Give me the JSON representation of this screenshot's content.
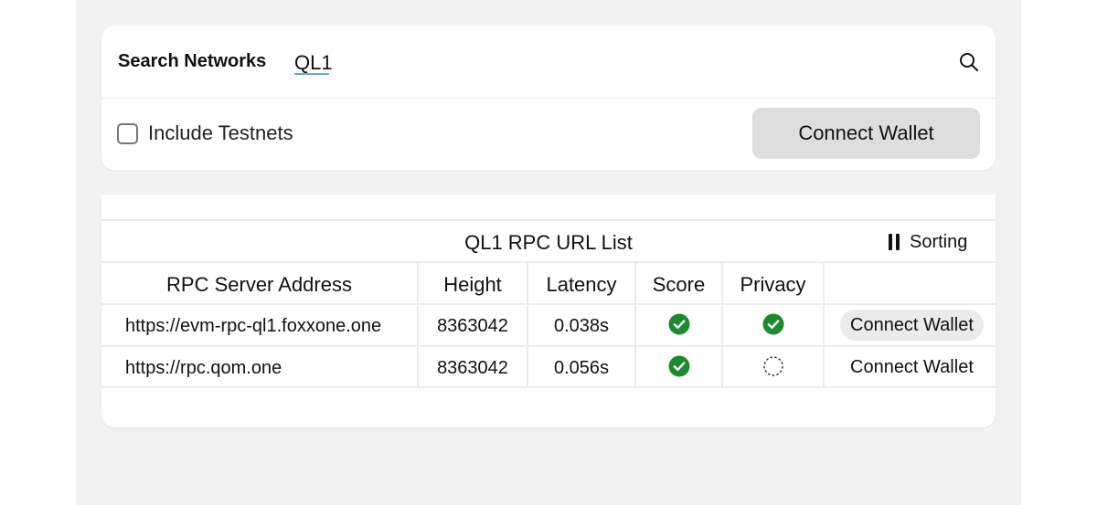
{
  "search": {
    "label": "Search Networks",
    "value": "QL1"
  },
  "options": {
    "include_testnets_label": "Include Testnets",
    "include_testnets_checked": false,
    "connect_wallet_label": "Connect Wallet"
  },
  "table": {
    "title": "QL1 RPC URL List",
    "sorting_label": "Sorting",
    "columns": [
      "RPC Server Address",
      "Height",
      "Latency",
      "Score",
      "Privacy",
      ""
    ],
    "rows": [
      {
        "address": "https://evm-rpc-ql1.foxxone.one",
        "height": "8363042",
        "latency": "0.038s",
        "score": "ok",
        "privacy": "ok",
        "action": "Connect Wallet"
      },
      {
        "address": "https://rpc.qom.one",
        "height": "8363042",
        "latency": "0.056s",
        "score": "ok",
        "privacy": "unknown",
        "action": "Connect Wallet"
      }
    ]
  },
  "colors": {
    "check_green": "#1e8a2f",
    "button_gray": "#dedede",
    "page_gray": "#f2f2f2",
    "underline_blue": "#6aa3e8"
  },
  "icons": {
    "search": "search-icon",
    "sorting": "pause-icon",
    "ok": "check-circle-icon",
    "unknown": "dashed-circle-icon"
  }
}
